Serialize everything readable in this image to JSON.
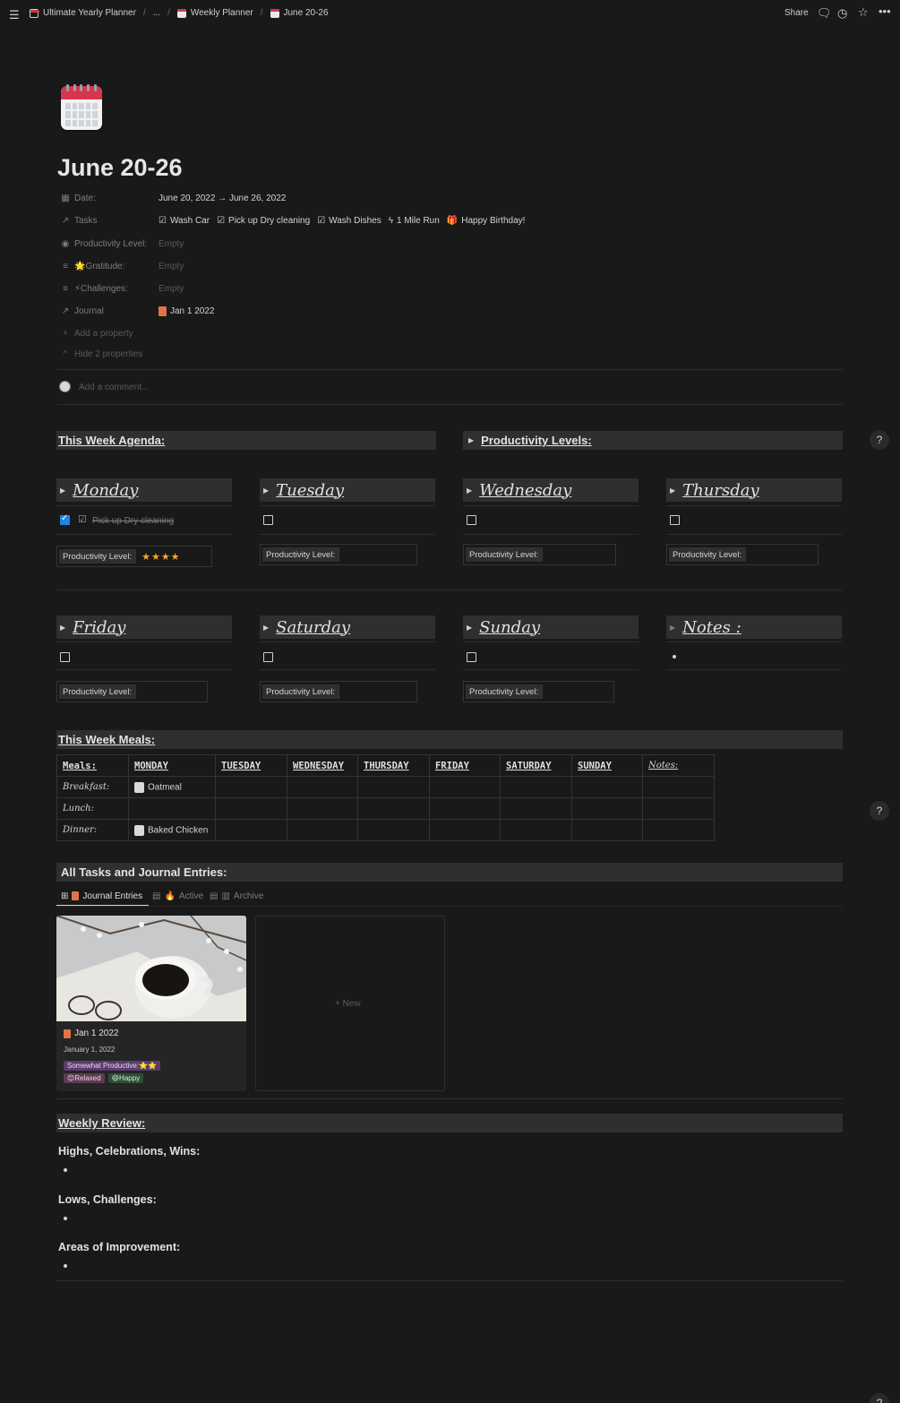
{
  "breadcrumb": {
    "items": [
      "Ultimate Yearly Planner",
      "...",
      "Weekly Planner",
      "June 20-26"
    ]
  },
  "topbar": {
    "share": "Share"
  },
  "page": {
    "title": "June 20-26"
  },
  "properties": {
    "date": {
      "name": "Date:",
      "value": "June 20, 2022 → June 26, 2022"
    },
    "tasks": {
      "name": "Tasks",
      "items": [
        "Wash Car",
        "Pick up Dry cleaning",
        "Wash Dishes",
        "1 Mile Run",
        "Happy Birthday!"
      ]
    },
    "productivity": {
      "name": "Productivity Level:",
      "value": "Empty"
    },
    "gratitude": {
      "name": "🌟Gratitude:",
      "value": "Empty"
    },
    "challenges": {
      "name": "⚡Challenges:",
      "value": "Empty"
    },
    "journal": {
      "name": "Journal",
      "value": "Jan 1 2022"
    },
    "add_property": "Add a property",
    "hide_properties": "Hide 2 properties"
  },
  "comment": {
    "placeholder": "Add a comment..."
  },
  "sections": {
    "agenda": "This Week Agenda:",
    "productivity_levels": "Productivity Levels:",
    "meals": "This Week Meals:",
    "tasks_journal": "All Tasks and Journal Entries:",
    "weekly_review": "Weekly Review:"
  },
  "days": [
    {
      "name": "Monday",
      "task": "Pick up Dry cleaning",
      "checked": true,
      "pl_label": "Productivity Level:",
      "stars": "★★★★"
    },
    {
      "name": "Tuesday",
      "pl_label": "Productivity Level:"
    },
    {
      "name": "Wednesday",
      "pl_label": "Productivity Level:"
    },
    {
      "name": "Thursday",
      "pl_label": "Productivity Level:"
    },
    {
      "name": "Friday",
      "pl_label": "Productivity Level:"
    },
    {
      "name": "Saturday",
      "pl_label": "Productivity Level:"
    },
    {
      "name": "Sunday",
      "pl_label": "Productivity Level:"
    },
    {
      "name": "Notes :"
    }
  ],
  "meals": {
    "headers": [
      "Meals:",
      "MONDAY",
      "TUESDAY",
      "WEDNESDAY",
      "THURSDAY",
      "FRIDAY",
      "SATURDAY",
      "SUNDAY",
      "Notes:"
    ],
    "rows": [
      {
        "label": "Breakfast:",
        "monday": "Oatmeal"
      },
      {
        "label": "Lunch:",
        "monday": ""
      },
      {
        "label": "Dinner:",
        "monday": "Baked Chicken"
      }
    ]
  },
  "views": {
    "tabs": [
      "Journal Entries",
      "Active",
      "Archive"
    ]
  },
  "journal_card": {
    "title": "Jan 1 2022",
    "date": "January 1, 2022",
    "tags": [
      "Somewhat Productive:⭐⭐",
      "😊Relaxed",
      "😄Happy"
    ]
  },
  "new_card": {
    "label": "+ New"
  },
  "review": {
    "highs": "Highs, Celebrations, Wins:",
    "lows": "Lows, Challenges:",
    "improvement": "Areas of Improvement:"
  },
  "help": "?"
}
